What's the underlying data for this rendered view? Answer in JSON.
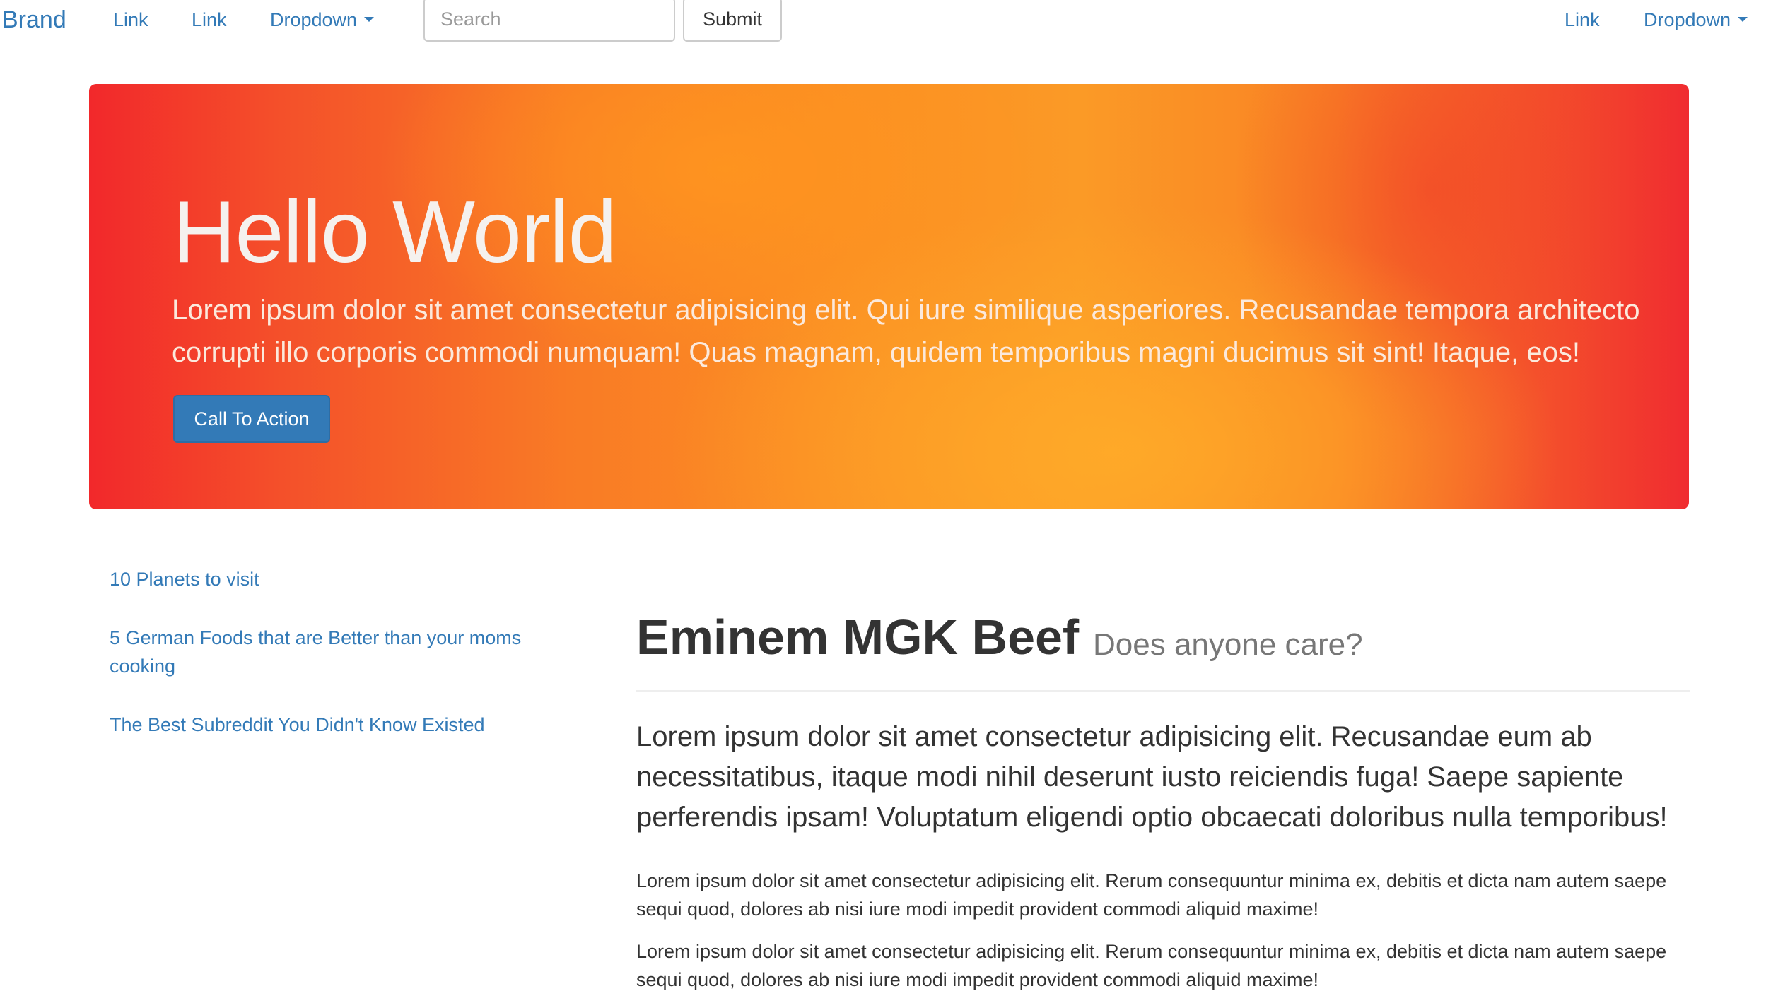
{
  "navbar": {
    "brand": "Brand",
    "left_links": [
      "Link",
      "Link"
    ],
    "dropdown_label": "Dropdown",
    "search_placeholder": "Search",
    "submit_label": "Submit",
    "right_link": "Link",
    "right_dropdown_label": "Dropdown"
  },
  "jumbotron": {
    "title": "Hello World",
    "text": "Lorem ipsum dolor sit amet consectetur adipisicing elit. Qui iure similique asperiores. Recusandae tempora architecto corrupti illo corporis commodi numquam! Quas magnam, quidem temporibus magni ducimus sit sint! Itaque, eos!",
    "cta_label": "Call To Action",
    "colors": {
      "red": "#f2282b",
      "orange": "#fb9a26"
    }
  },
  "sidebar": {
    "links": [
      "10 Planets to visit",
      "5 German Foods that are Better than your moms cooking",
      "The Best Subreddit You Didn't Know Existed"
    ]
  },
  "article": {
    "title": "Eminem MGK Beef",
    "subtitle": "Does anyone care?",
    "lead": "Lorem ipsum dolor sit amet consectetur adipisicing elit. Recusandae eum ab necessitatibus, itaque modi nihil deserunt iusto reiciendis fuga! Saepe sapiente perferendis ipsam! Voluptatum eligendi optio obcaecati doloribus nulla temporibus!",
    "paragraphs": [
      "Lorem ipsum dolor sit amet consectetur adipisicing elit. Rerum consequuntur minima ex, debitis et dicta nam autem saepe sequi quod, dolores ab nisi iure modi impedit provident commodi aliquid maxime!",
      "Lorem ipsum dolor sit amet consectetur adipisicing elit. Rerum consequuntur minima ex, debitis et dicta nam autem saepe sequi quod, dolores ab nisi iure modi impedit provident commodi aliquid maxime!"
    ]
  },
  "theme": {
    "link_color": "#337ab7",
    "primary_button": "#337ab7",
    "text_color": "#333333",
    "muted_color": "#777777"
  }
}
